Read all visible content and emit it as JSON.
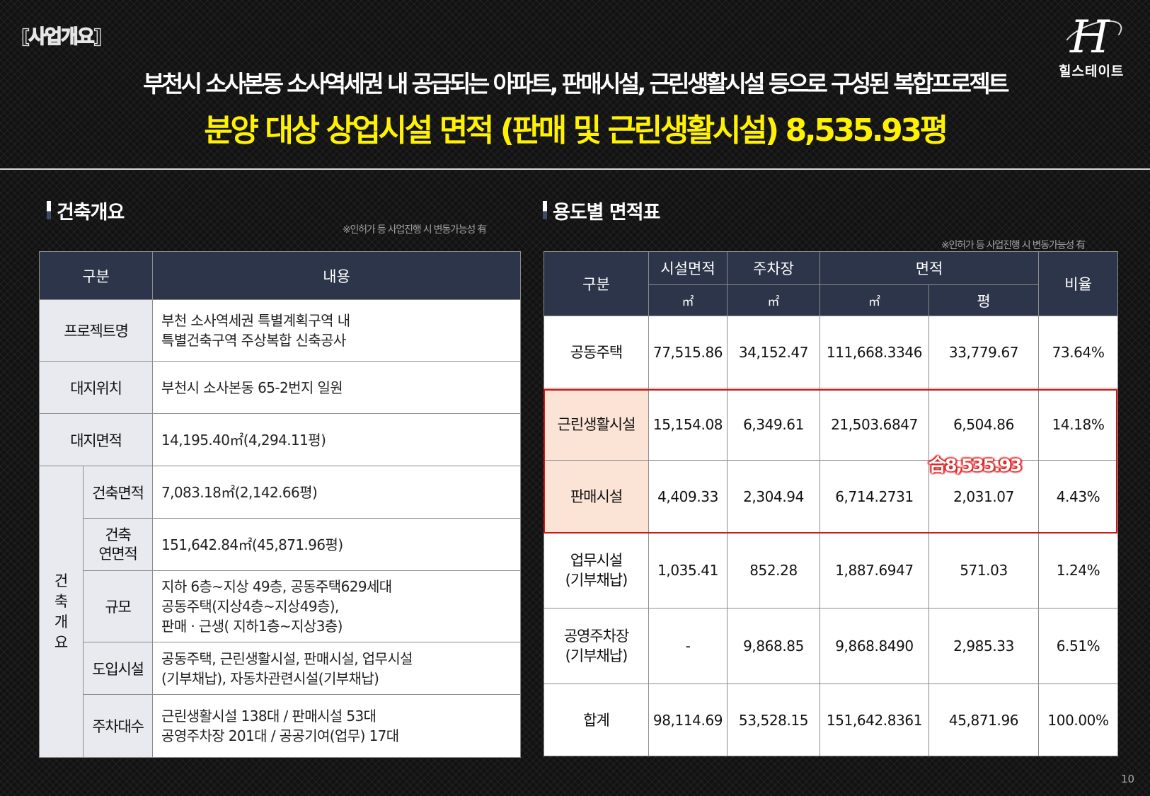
{
  "header": {
    "tag": "[사업개요]",
    "subtitle": "부천시 소사본동 소사역세권 내 공급되는 아파트, 판매시설, 근린생활시설 등으로 구성된 복합프로젝트",
    "headline": "분양 대상 상업시설 면적 (판매 및 근린생활시설) 8,535.93평",
    "logo_text": "힐스테이트",
    "logo_mark": "H"
  },
  "building": {
    "title": "건축개요",
    "note": "※인허가 등 사업진행 시 변동가능성 有",
    "headers": [
      "구분",
      "내용"
    ],
    "group_label": "건축개요",
    "rows": [
      {
        "label": "프로젝트명",
        "value_lines": [
          "부천 소사역세권 특별계획구역 내",
          "특별건축구역 주상복합 신축공사"
        ]
      },
      {
        "label": "대지위치",
        "value_lines": [
          "부천시 소사본동 65-2번지 일원"
        ]
      },
      {
        "label": "대지면적",
        "value_lines": [
          "14,195.40㎡(4,294.11평)"
        ]
      },
      {
        "label": "건축면적",
        "value_lines": [
          "7,083.18㎡(2,142.66평)"
        ]
      },
      {
        "label_lines": [
          "건축",
          "연면적"
        ],
        "value_lines": [
          "151,642.84㎡(45,871.96평)"
        ]
      },
      {
        "label": "규모",
        "value_lines": [
          "지하 6층~지상 49층, 공동주택629세대",
          "공동주택(지상4층~지상49층),",
          "판매 · 근생( 지하1층~지상3층)"
        ]
      },
      {
        "label": "도입시설",
        "value_lines": [
          "공동주택, 근린생활시설, 판매시설, 업무시설",
          "(기부채납), 자동차관련시설(기부채납)"
        ]
      },
      {
        "label": "주차대수",
        "value_lines": [
          "근린생활시설 138대 / 판매시설 53대",
          "공영주차장 201대 / 공공기여(업무) 17대"
        ]
      }
    ]
  },
  "area": {
    "title": "용도별 면적표",
    "note": "※인허가 등 사업진행 시 변동가능성 有",
    "headers": {
      "category": "구분",
      "facility": "시설면적",
      "parking": "주차장",
      "area": "면적",
      "ratio": "비율",
      "unit_m2": "㎡",
      "unit_pyeong": "평"
    },
    "rows": [
      {
        "label_lines": [
          "공동주택"
        ],
        "facility": "77,515.86",
        "parking": "34,152.47",
        "m2": "111,668.3346",
        "pyeong": "33,779.67",
        "ratio": "73.64%"
      },
      {
        "label_lines": [
          "근린생활시설"
        ],
        "facility": "15,154.08",
        "parking": "6,349.61",
        "m2": "21,503.6847",
        "pyeong": "6,504.86",
        "ratio": "14.18%"
      },
      {
        "label_lines": [
          "판매시설"
        ],
        "facility": "4,409.33",
        "parking": "2,304.94",
        "m2": "6,714.2731",
        "pyeong": "2,031.07",
        "ratio": "4.43%"
      },
      {
        "label_lines": [
          "업무시설",
          "(기부채납)"
        ],
        "facility": "1,035.41",
        "parking": "852.28",
        "m2": "1,887.6947",
        "pyeong": "571.03",
        "ratio": "1.24%"
      },
      {
        "label_lines": [
          "공영주차장",
          "(기부채납)"
        ],
        "facility": "-",
        "parking": "9,868.85",
        "m2": "9,868.8490",
        "pyeong": "2,985.33",
        "ratio": "6.51%"
      },
      {
        "label_lines": [
          "합계"
        ],
        "facility": "98,114.69",
        "parking": "53,528.15",
        "m2": "151,642.8361",
        "pyeong": "45,871.96",
        "ratio": "100.00%"
      }
    ],
    "sum_label": "合8,535.93",
    "highlight_color": "#cc1a1a"
  },
  "page_number": "10"
}
